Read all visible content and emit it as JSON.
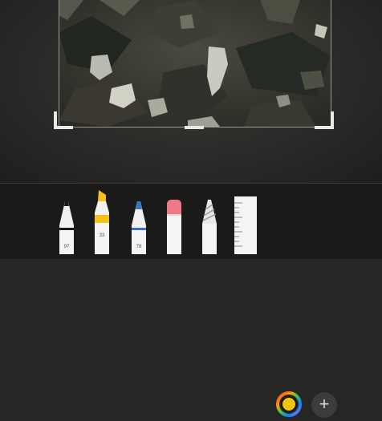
{
  "toolbar": {
    "tools": [
      {
        "name": "pen",
        "width_label": "97"
      },
      {
        "name": "marker",
        "width_label": "33",
        "color": "#f4c21b"
      },
      {
        "name": "pencil",
        "width_label": "78",
        "color": "#3a72c8"
      },
      {
        "name": "eraser"
      },
      {
        "name": "lasso"
      },
      {
        "name": "ruler"
      }
    ],
    "selected_color": "#f2c40f",
    "add_label": "+"
  }
}
